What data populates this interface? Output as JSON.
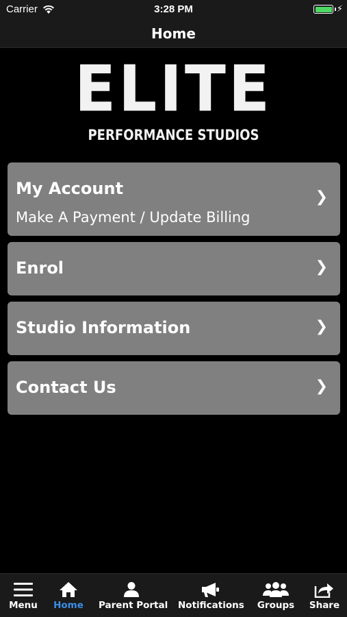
{
  "status_bar": {
    "carrier": "Carrier",
    "time": "3:28 PM",
    "battery_level": 1.0,
    "charging": true
  },
  "nav": {
    "title": "Home"
  },
  "logo": {
    "main": "ELITE",
    "sub": "PERFORMANCE STUDIOS"
  },
  "menu": {
    "items": [
      {
        "title": "My Account",
        "subtitle": "Make A Payment / Update Billing",
        "chevron": "❯"
      },
      {
        "title": "Enrol",
        "chevron": "❯"
      },
      {
        "title": "Studio Information",
        "chevron": "❯"
      },
      {
        "title": "Contact Us",
        "chevron": "❯"
      }
    ]
  },
  "tab_bar": {
    "accent_color": "#3b8ee6",
    "tabs": [
      {
        "label": "Menu",
        "icon": "hamburger-icon"
      },
      {
        "label": "Home",
        "icon": "home-icon",
        "active": true
      },
      {
        "label": "Parent Portal",
        "icon": "person-icon"
      },
      {
        "label": "Notifications",
        "icon": "megaphone-icon"
      },
      {
        "label": "Groups",
        "icon": "group-icon"
      },
      {
        "label": "Share",
        "icon": "share-icon"
      }
    ]
  }
}
